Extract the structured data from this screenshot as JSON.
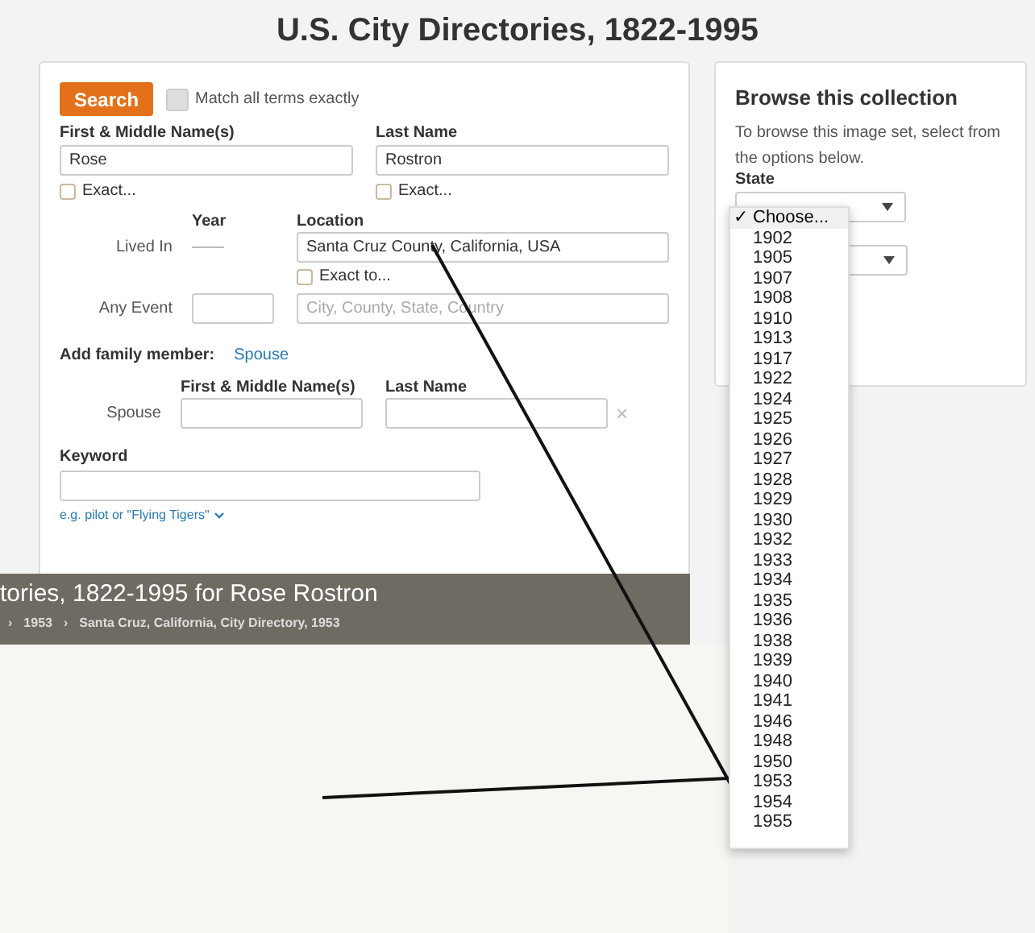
{
  "page_title": "U.S. City Directories, 1822-1995",
  "search_form": {
    "search_button": "Search",
    "match_exact": {
      "label": "Match all terms exactly",
      "checked": false
    },
    "first_name": {
      "label": "First & Middle Name(s)",
      "value": "Rose",
      "exact": {
        "label": "Exact...",
        "checked": false
      }
    },
    "last_name": {
      "label": "Last Name",
      "value": "Rostron",
      "exact": {
        "label": "Exact...",
        "checked": false
      }
    },
    "year_label": "Year",
    "location_label": "Location",
    "lived_in": {
      "label": "Lived In",
      "year_dash": "——",
      "location": "Santa Cruz County, California, USA",
      "exact_to": {
        "label": "Exact to...",
        "checked": false
      }
    },
    "any_event": {
      "label": "Any Event",
      "location_placeholder": "City, County, State, Country"
    },
    "family": {
      "label": "Add family member:",
      "link": "Spouse"
    },
    "spouse": {
      "label": "Spouse",
      "first_label": "First & Middle Name(s)",
      "last_label": "Last Name",
      "remove": "×"
    },
    "keyword": {
      "label": "Keyword",
      "hint": "e.g. pilot or \"Flying Tigers\""
    }
  },
  "browse": {
    "title": "Browse this collection",
    "text": "To browse this image set, select from the options below.",
    "state_label": "State"
  },
  "dropdown": {
    "check_mark": "✓",
    "items": [
      {
        "label": "Choose...",
        "selected": true
      },
      {
        "label": "1902",
        "selected": false
      },
      {
        "label": "1905",
        "selected": false
      },
      {
        "label": "1907",
        "selected": false
      },
      {
        "label": "1908",
        "selected": false
      },
      {
        "label": "1910",
        "selected": false
      },
      {
        "label": "1913",
        "selected": false
      },
      {
        "label": "1917",
        "selected": false
      },
      {
        "label": "1922",
        "selected": false
      },
      {
        "label": "1924",
        "selected": false
      },
      {
        "label": "1925",
        "selected": false
      },
      {
        "label": "1926",
        "selected": false
      },
      {
        "label": "1927",
        "selected": false
      },
      {
        "label": "1928",
        "selected": false
      },
      {
        "label": "1929",
        "selected": false
      },
      {
        "label": "1930",
        "selected": false
      },
      {
        "label": "1932",
        "selected": false
      },
      {
        "label": "1933",
        "selected": false
      },
      {
        "label": "1934",
        "selected": false
      },
      {
        "label": "1935",
        "selected": false
      },
      {
        "label": "1936",
        "selected": false
      },
      {
        "label": "1938",
        "selected": false
      },
      {
        "label": "1939",
        "selected": false
      },
      {
        "label": "1940",
        "selected": false
      },
      {
        "label": "1941",
        "selected": false
      },
      {
        "label": "1946",
        "selected": false
      },
      {
        "label": "1948",
        "selected": false
      },
      {
        "label": "1950",
        "selected": false
      },
      {
        "label": "1953",
        "selected": false
      },
      {
        "label": "1954",
        "selected": false
      },
      {
        "label": "1955",
        "selected": false
      }
    ]
  },
  "viewer": {
    "title": "tories, 1822-1995 for Rose Rostron",
    "separator": "›",
    "breadcrumbs": [
      "1953",
      "Santa Cruz, California, City Directory, 1953"
    ]
  }
}
